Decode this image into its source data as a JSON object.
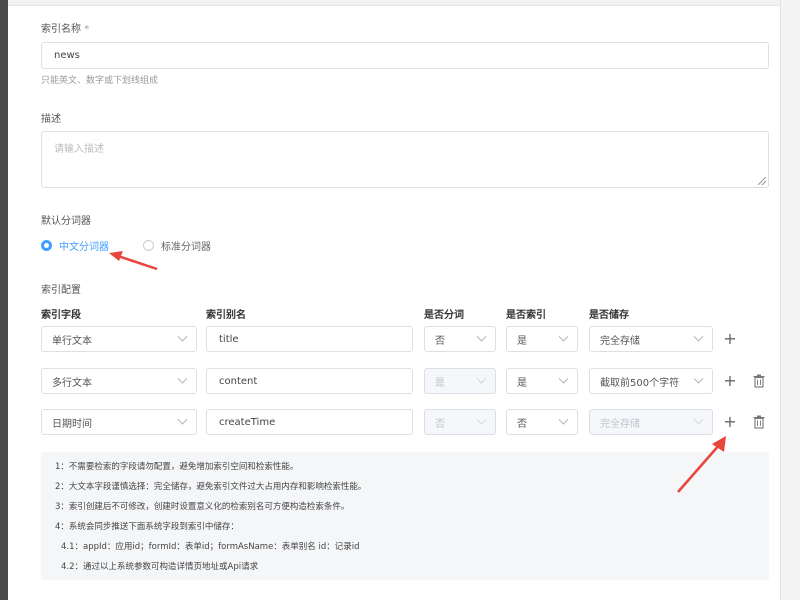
{
  "index_name": {
    "label": "索引名称",
    "required_mark": "*",
    "value": "news",
    "hint": "只能英文、数字或下划线组成"
  },
  "description": {
    "label": "描述",
    "placeholder": "请输入描述"
  },
  "analyzer": {
    "label": "默认分词器",
    "options": [
      {
        "label": "中文分词器",
        "checked": true
      },
      {
        "label": "标准分词器",
        "checked": false
      }
    ]
  },
  "config": {
    "label": "索引配置",
    "columns": [
      "索引字段",
      "索引别名",
      "是否分词",
      "是否索引",
      "是否储存"
    ],
    "rows": [
      {
        "field": "单行文本",
        "alias": "title",
        "tokenize": "否",
        "index": "是",
        "store": "完全存储",
        "tokenize_disabled": false,
        "store_disabled": false,
        "deletable": false
      },
      {
        "field": "多行文本",
        "alias": "content",
        "tokenize": "是",
        "index": "是",
        "store": "截取前500个字符",
        "tokenize_disabled": true,
        "store_disabled": false,
        "deletable": true
      },
      {
        "field": "日期时间",
        "alias": "createTime",
        "tokenize": "否",
        "index": "否",
        "store": "完全存储",
        "tokenize_disabled": true,
        "store_disabled": true,
        "deletable": true
      }
    ]
  },
  "notes": [
    "1：不需要检索的字段请勿配置，避免增加索引空间和检索性能。",
    "2：大文本字段谨慎选择：完全储存，避免索引文件过大占用内存和影响检索性能。",
    "3：索引创建后不可修改，创建时设置意义化的检索别名可方便构造检索条件。",
    "4：系统会同步推送下面系统字段到索引中储存：",
    "4.1：appId：应用id；formId：表单id；formAsName：表单别名 id：记录id",
    "4.2：通过以上系统参数可构造详情页地址或Api请求"
  ],
  "colors": {
    "accent": "#409eff",
    "arrow": "#e8453c"
  }
}
